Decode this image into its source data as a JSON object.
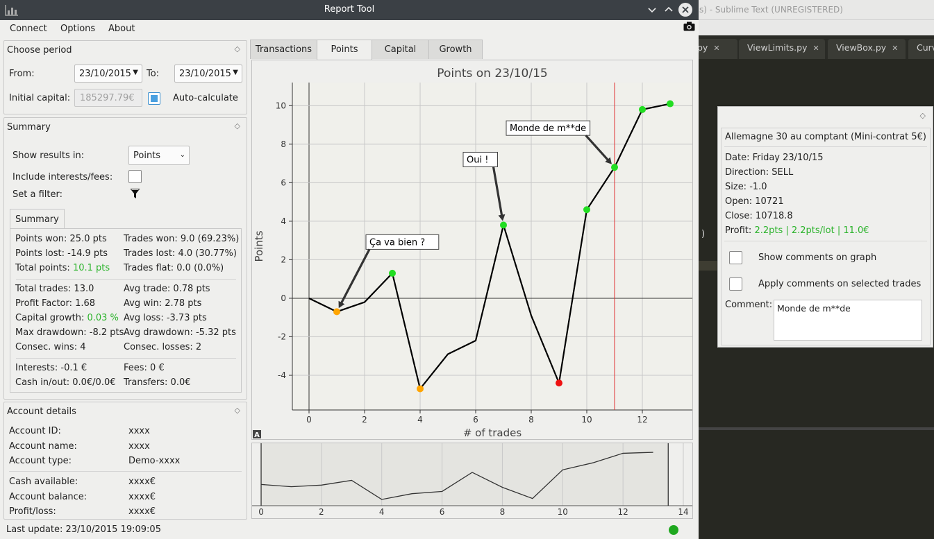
{
  "window": {
    "title": "Report Tool"
  },
  "menu": [
    "Connect",
    "Options",
    "About"
  ],
  "period": {
    "title": "Choose period",
    "from_label": "From:",
    "from_value": "23/10/2015",
    "to_label": "To:",
    "to_value": "23/10/2015",
    "capital_label": "Initial capital:",
    "capital_value": "185297.79€",
    "auto_label": "Auto-calculate"
  },
  "summary_panel": {
    "title": "Summary",
    "show_label": "Show results in:",
    "show_value": "Points",
    "interests_label": "Include interests/fees:",
    "filter_label": "Set a filter:",
    "tab_label": "Summary",
    "left": [
      [
        "Points won: 25.0 pts",
        "Points lost: -14.9 pts"
      ],
      [
        "Total trades: 13.0",
        "Profit Factor: 1.68",
        "Max drawdown: -8.2 pts",
        "Consec. wins: 4"
      ],
      [
        "Interests: -0.1 €",
        "Cash in/out: 0.0€/0.0€"
      ]
    ],
    "total_points_label": "Total points:",
    "total_points_value": "10.1 pts",
    "capital_growth_label": "Capital growth:",
    "capital_growth_value": "0.03 %",
    "right": [
      [
        "Trades won: 9.0 (69.23%)",
        "Trades lost: 4.0 (30.77%)",
        "Trades flat: 0.0 (0.0%)"
      ],
      [
        "Avg trade: 0.78 pts",
        "Avg win: 2.78 pts",
        "Avg loss: -3.73 pts",
        "Avg drawdown: -5.32 pts",
        "Consec. losses: 2"
      ],
      [
        "Fees: 0 €",
        "Transfers: 0.0€"
      ]
    ]
  },
  "account": {
    "title": "Account details",
    "rows": [
      [
        "Account ID:",
        "xxxx"
      ],
      [
        "Account name:",
        "xxxx"
      ],
      [
        "Account type:",
        "Demo-xxxx"
      ],
      [
        "Cash available:",
        "xxxx€"
      ],
      [
        "Account balance:",
        "xxxx€"
      ],
      [
        "Profit/loss:",
        "xxxx€"
      ]
    ]
  },
  "status": {
    "text": "Last update: 23/10/2015 19:09:05",
    "color": "#1fa81f"
  },
  "tabs": [
    "Transactions",
    "Points",
    "Capital",
    "Growth"
  ],
  "active_tab": 1,
  "chart_data": {
    "type": "line",
    "title": "Points on 23/10/15",
    "xlabel": "# of trades",
    "ylabel": "Points",
    "xlim": [
      -0.6,
      13.8
    ],
    "ylim": [
      -5.8,
      11.2
    ],
    "xticks": [
      0,
      2,
      4,
      6,
      8,
      10,
      12
    ],
    "yticks": [
      -4,
      -2,
      0,
      2,
      4,
      6,
      8,
      10
    ],
    "x": [
      0,
      1,
      2,
      3,
      4,
      5,
      6,
      7,
      8,
      9,
      10,
      11,
      12,
      13
    ],
    "y": [
      0,
      -0.7,
      -0.2,
      1.3,
      -4.7,
      -2.9,
      -2.2,
      3.8,
      -0.9,
      -4.4,
      4.6,
      6.8,
      9.8,
      10.1
    ],
    "markers": [
      {
        "x": 1,
        "y": -0.7,
        "color": "#ffa500"
      },
      {
        "x": 3,
        "y": 1.3,
        "color": "#22dd22"
      },
      {
        "x": 4,
        "y": -4.7,
        "color": "#ffa500"
      },
      {
        "x": 7,
        "y": 3.8,
        "color": "#22dd22"
      },
      {
        "x": 9,
        "y": -4.4,
        "color": "#ee1111"
      },
      {
        "x": 10,
        "y": 4.6,
        "color": "#22dd22"
      },
      {
        "x": 11,
        "y": 6.8,
        "color": "#22dd22"
      },
      {
        "x": 12,
        "y": 9.8,
        "color": "#22dd22"
      },
      {
        "x": 13,
        "y": 10.1,
        "color": "#22dd22"
      }
    ],
    "annotations": [
      {
        "text": "Ça va bien ?",
        "x": 1,
        "y": -0.7
      },
      {
        "text": "Oui !",
        "x": 7,
        "y": 3.8
      },
      {
        "text": "Monde de m**de",
        "x": 11,
        "y": 6.8
      }
    ],
    "vline_x": 11,
    "nav_xticks": [
      0,
      2,
      4,
      6,
      8,
      10,
      12,
      14
    ],
    "nav_xlim": [
      -0.3,
      14.3
    ]
  },
  "trade": {
    "title": "Allemagne 30 au comptant (Mini-contrat 5€)",
    "lines": [
      "Date: Friday 23/10/15",
      "Direction: SELL",
      "Size: -1.0",
      "Open: 10721",
      "Close: 10718.8"
    ],
    "profit_label": "Profit:",
    "profit_value": "2.2pts | 2.2pts/lot | 11.0€",
    "show_comments": "Show comments on graph",
    "apply_comments": "Apply comments on selected trades",
    "comment_label": "Comment:",
    "comment_value": "Monde de m**de"
  },
  "sublime": {
    "title": "s) - Sublime Text (UNREGISTERED)",
    "tabs": [
      "py",
      "ViewLimits.py",
      "ViewBox.py",
      "Curv"
    ],
    "code_char": ")"
  }
}
